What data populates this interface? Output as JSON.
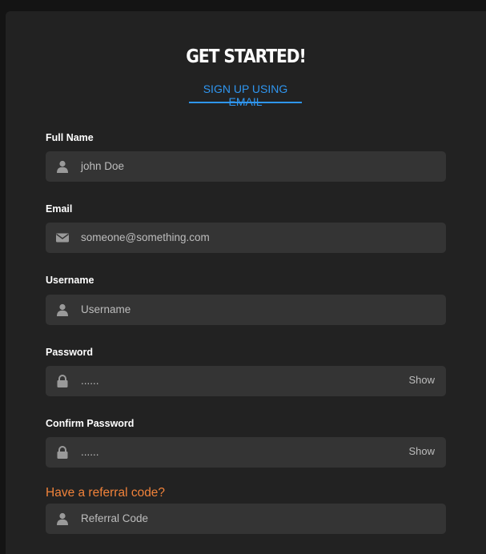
{
  "header": {
    "title": "GET STARTED!",
    "tab_label": "SIGN UP USING EMAIL"
  },
  "form": {
    "full_name": {
      "label": "Full Name",
      "value": "john Doe",
      "icon": "user-icon"
    },
    "email": {
      "label": "Email",
      "value": "someone@something.com",
      "icon": "envelope-icon"
    },
    "username": {
      "label": "Username",
      "placeholder": "Username",
      "icon": "user-icon"
    },
    "password": {
      "label": "Password",
      "value": "......",
      "toggle": "Show",
      "icon": "lock-icon"
    },
    "confirm_password": {
      "label": "Confirm Password",
      "value": "......",
      "toggle": "Show",
      "icon": "lock-icon"
    },
    "referral": {
      "label": "Have a referral code?",
      "placeholder": "Referral Code",
      "icon": "user-icon"
    }
  },
  "colors": {
    "background": "#141414",
    "panel": "#222222",
    "field": "#343434",
    "accent": "#2f96f0",
    "referral": "#f0823a",
    "muted_text": "#bdbdbd"
  }
}
